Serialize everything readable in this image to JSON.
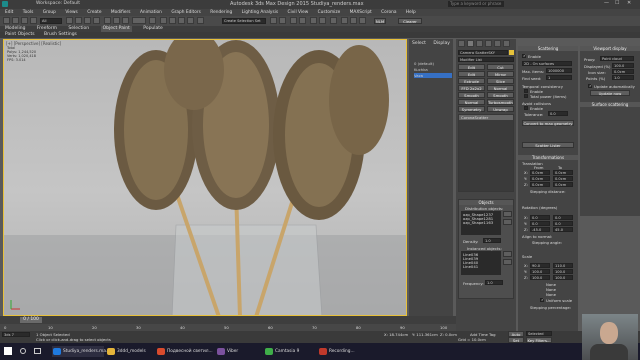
{
  "window": {
    "title": "Autodesk 3ds Max Design 2015   Studiya_renders.max",
    "workspace": "Workspace: Default",
    "search_placeholder": "Type a keyword or phrase"
  },
  "menu": [
    "Edit",
    "Tools",
    "Group",
    "Views",
    "Create",
    "Modifiers",
    "Animation",
    "Graph Editors",
    "Rendering",
    "Lighting Analysis",
    "Civil View",
    "Customize",
    "MAXScript",
    "Corona",
    "Help"
  ],
  "toolbar": {
    "filter_value": "All",
    "create_selection_set": "Create Selection Set",
    "nlm": "NLM",
    "clear_label": "Clearer"
  },
  "ribbon_tabs": [
    "Modeling",
    "Freeform",
    "Selection",
    "Object Paint",
    "Populate"
  ],
  "ribbon_sub": [
    "Paint Objects",
    "Brush Settings"
  ],
  "viewport": {
    "label": "[+] [Perspective] [Realistic]",
    "stats": [
      "Total",
      "Polys: 1,244,520",
      "Verts: 1,020,418",
      "FPS: 3.014"
    ]
  },
  "side_panel": {
    "tabs": [
      "Select",
      "Display"
    ],
    "layers": [
      "0 (default)",
      "Kuchka",
      "Vaza"
    ]
  },
  "command_panel": {
    "name_field": "Camera ScatterSKY",
    "modifier_list": "Modifier List",
    "modifier_buttons": [
      [
        "Edit",
        "Cut"
      ],
      [
        "Edit",
        "Mirror"
      ],
      [
        "Extrude",
        "Slice"
      ],
      [
        "FFD 2x2x2",
        "Normal"
      ],
      [
        "Smooth",
        "Smooth"
      ],
      [
        "Normal",
        "Turbosmooth"
      ],
      [
        "Symmetry",
        "Unwrap"
      ]
    ],
    "stack_item": "CoronaScatter",
    "objects_header": "Objects",
    "distribute_label": "Distribution objects:",
    "distribute_items": [
      "ozp_Shape1237",
      "ozp_Shape1281",
      "ozp_Shape1163"
    ],
    "density_label": "Density:",
    "density_value": "1.0",
    "instanced_label": "Instanced objects:",
    "instanced_items": [
      "Line036",
      "Line039",
      "Line040",
      "Line041"
    ],
    "frequency_label": "Frequency:",
    "frequency_value": "1.0"
  },
  "scatter_panel": {
    "header": "Scattering",
    "enable_label": "Enable",
    "mode_value": "2D - On surfaces",
    "max_items_label": "Max. items:",
    "max_items_value": "1000000",
    "find_seed_label": "Find seed:",
    "find_seed_value": "1",
    "temporal_label": "Temporal consistency",
    "enable2_label": "Enable",
    "total_label": "Total power (items)",
    "avoid_label": "Avoid collisions",
    "enable3_label": "Enable",
    "tolerance_label": "Tolerance:",
    "tolerance_value": "0.0",
    "convert_btn": "Convert to max geometry",
    "lister_btn": "Scatter Lister",
    "transform_header": "Transformations",
    "translation_label": "Translation",
    "from_label": "From",
    "to_label": "To",
    "translation_rows": [
      [
        "X:",
        "0.0cm",
        "0.0cm"
      ],
      [
        "Y:",
        "0.0cm",
        "0.0cm"
      ],
      [
        "Z:",
        "0.0cm",
        "0.0cm"
      ]
    ],
    "stepping_label": "Stepping distance:",
    "rotation_label": "Rotation (degrees)",
    "rotation_rows": [
      [
        "X:",
        "0.0",
        "0.0"
      ],
      [
        "Y:",
        "0.0",
        "0.0"
      ],
      [
        "Z:",
        "-45.0",
        "45.0"
      ]
    ],
    "align_label": "Align to normal:",
    "stepping_angle": "Stepping angle:",
    "scale_label": "Scale",
    "scale_rows": [
      [
        "X:",
        "90.0",
        "110.0"
      ],
      [
        "Y:",
        "100.0",
        "100.0"
      ],
      [
        "Z:",
        "100.0",
        "100.0"
      ]
    ],
    "none_labels": [
      "None",
      "None",
      "None"
    ],
    "uniform_label": "Uniform scale",
    "stepping_pct": "Stepping percentage:"
  },
  "viewport_panel": {
    "header": "Viewport display",
    "proxy_label": "Proxy:",
    "proxy_value": "Point cloud",
    "displayed_label": "Displayed (%)",
    "displayed_value": "100.0",
    "icon_size_label": "Icon size:",
    "icon_size_value": "0.0cm",
    "points_label": "Points (%)",
    "points_value": "1.0",
    "update_auto": "Update automatically",
    "update_btn": "Update now",
    "surface_header": "Surface scattering"
  },
  "timeline": {
    "frame": "0 / 100",
    "ticks": [
      "0",
      "10",
      "20",
      "30",
      "40",
      "50",
      "60",
      "70",
      "80",
      "90",
      "100"
    ]
  },
  "status": {
    "selected": "1 Object Selected",
    "hint": "Click or click-and-drag to select objects",
    "x": "X: 18.744cm",
    "y": "Y: 111.361cm",
    "z": "Z: 0.0cm",
    "grid": "Grid = 10.0cm",
    "auto_key": "Auto Key",
    "set_key": "Set Key",
    "selected_dd": "Selected",
    "key_filters": "Key Filters...",
    "add_time_tag": "Add Time Tag",
    "cmd_input": "3ds 7"
  },
  "taskbar": {
    "apps": [
      "Studiya_renders.ma...",
      "3ddd_models",
      "Подвесной светил...",
      "Viber",
      "Camtasia 9",
      "Recording..."
    ],
    "colors": [
      "#1f7ae0",
      "#e4b43a",
      "#d94b2d",
      "#7b519d",
      "#3fae49",
      "#c0392b"
    ]
  }
}
